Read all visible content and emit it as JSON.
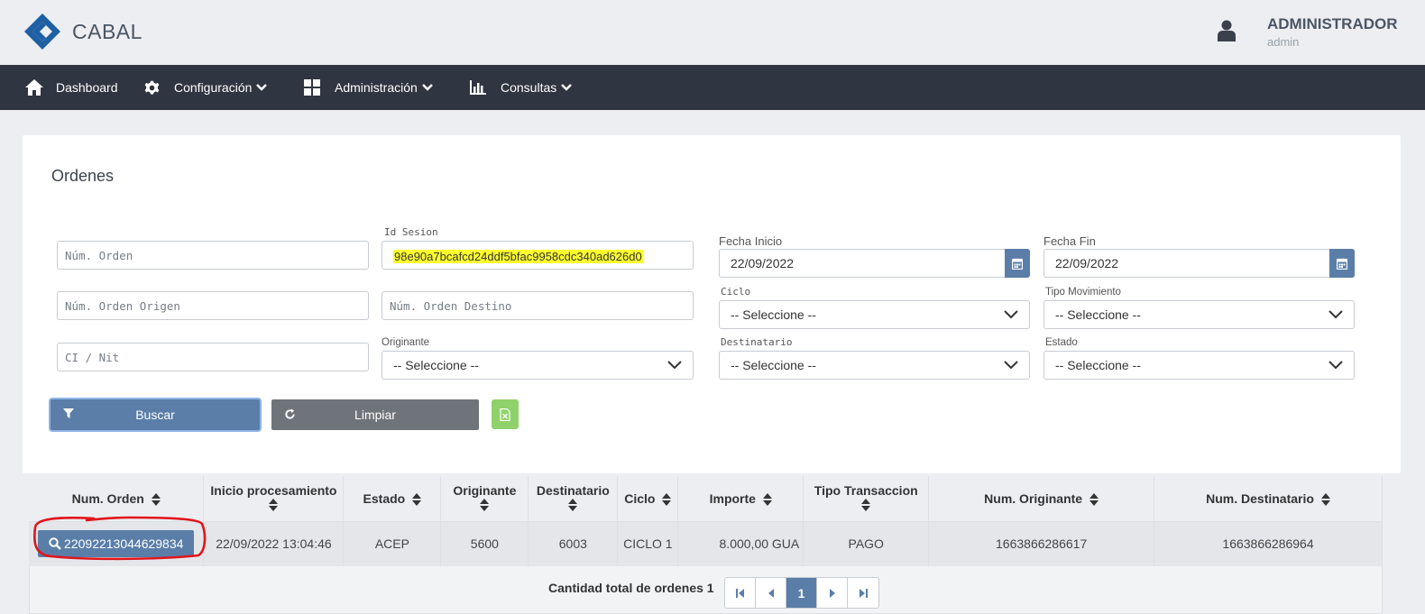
{
  "header": {
    "brand": "CABAL",
    "user_name": "ADMINISTRADOR",
    "user_login": "admin"
  },
  "nav": {
    "items": [
      {
        "label": "Dashboard",
        "icon": "home-icon"
      },
      {
        "label": "Configuración",
        "icon": "gear-icon"
      },
      {
        "label": "Administración",
        "icon": "grid-icon"
      },
      {
        "label": "Consultas",
        "icon": "bar-chart-icon"
      }
    ]
  },
  "panel": {
    "title": "Ordenes",
    "filters": {
      "num_orden_placeholder": "Núm. Orden",
      "id_sesion_label": "Id Sesion",
      "id_sesion_value": "98e90a7bcafcd24ddf5bfac9958cdc340ad626d0",
      "num_orden_origen_placeholder": "Núm. Orden Origen",
      "num_orden_destino_placeholder": "Núm. Orden Destino",
      "ci_nit_placeholder": "CI / Nit",
      "originante_label": "Originante",
      "originante_value": "-- Seleccione --",
      "fecha_inicio_label": "Fecha Inicio",
      "fecha_inicio_value": "22/09/2022",
      "fecha_fin_label": "Fecha Fin",
      "fecha_fin_value": "22/09/2022",
      "ciclo_label": "Ciclo",
      "ciclo_value": "-- Seleccione --",
      "tipo_movimiento_label": "Tipo Movimiento",
      "tipo_movimiento_value": "-- Seleccione --",
      "destinatario_label": "Destinatario",
      "destinatario_value": "-- Seleccione --",
      "estado_label": "Estado",
      "estado_value": "-- Seleccione --"
    },
    "buttons": {
      "search": "Buscar",
      "clear": "Limpiar"
    }
  },
  "table": {
    "columns": [
      "Num. Orden",
      "Inicio procesamiento",
      "Estado",
      "Originante",
      "Destinatario",
      "Ciclo",
      "Importe",
      "Tipo Transaccion",
      "Num. Originante",
      "Num. Destinatario"
    ],
    "rows": [
      [
        "22092213044629834",
        "22/09/2022 13:04:46",
        "ACEP",
        "5600",
        "6003",
        "CICLO 1",
        "8.000,00 GUA",
        "PAGO",
        "1663866286617",
        "1663866286964"
      ]
    ]
  },
  "footer": {
    "total_label": "Cantidad total de ordenes 1",
    "current_page": "1"
  },
  "colors": {
    "primary": "#5a7ea8",
    "navbar": "#2f3541",
    "excel": "#8fd16a",
    "highlight": "#ffff2e",
    "annotation": "#e0151b"
  }
}
